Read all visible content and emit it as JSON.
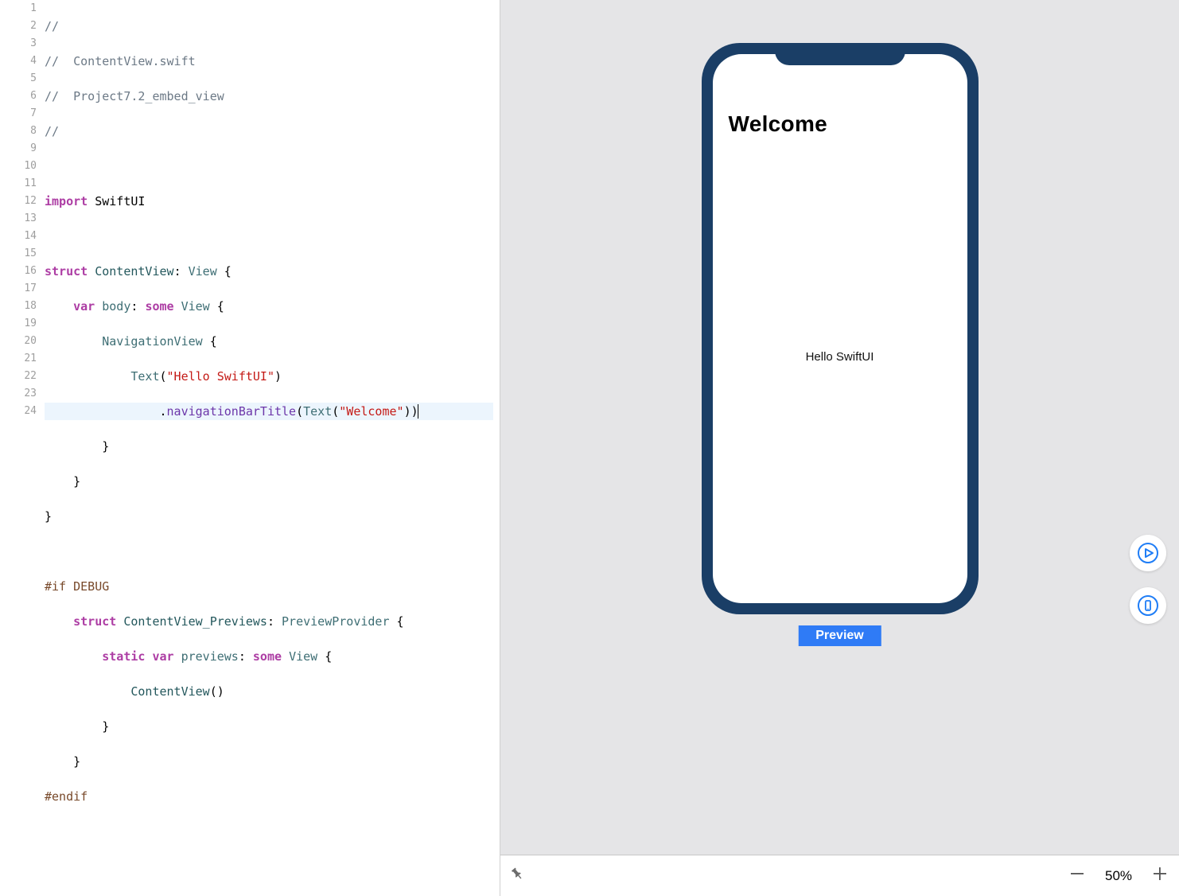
{
  "code": {
    "comment_marker": "//",
    "comment_file": "//  ContentView.swift",
    "comment_proj": "//  Project7.2_embed_view",
    "import_kw": "import",
    "import_mod": "SwiftUI",
    "struct_kw": "struct",
    "ContentView": "ContentView",
    "View": "View",
    "var_kw": "var",
    "body": "body",
    "some_kw": "some",
    "NavigationView": "NavigationView",
    "Text": "Text",
    "hello_str": "\"Hello SwiftUI\"",
    "navTitle": "navigationBarTitle",
    "welcome_str": "\"Welcome\"",
    "if_debug": "#if DEBUG",
    "ContentView_Previews": "ContentView_Previews",
    "PreviewProvider": "PreviewProvider",
    "static_kw": "static",
    "previews": "previews",
    "ContentViewCall": "ContentView",
    "endif": "#endif"
  },
  "preview": {
    "nav_title": "Welcome",
    "center_text": "Hello SwiftUI",
    "label": "Preview"
  },
  "bottombar": {
    "zoom": "50%"
  },
  "lines": [
    "1",
    "2",
    "3",
    "4",
    "5",
    "6",
    "7",
    "8",
    "9",
    "10",
    "11",
    "12",
    "13",
    "14",
    "15",
    "16",
    "17",
    "18",
    "19",
    "20",
    "21",
    "22",
    "23",
    "24"
  ]
}
